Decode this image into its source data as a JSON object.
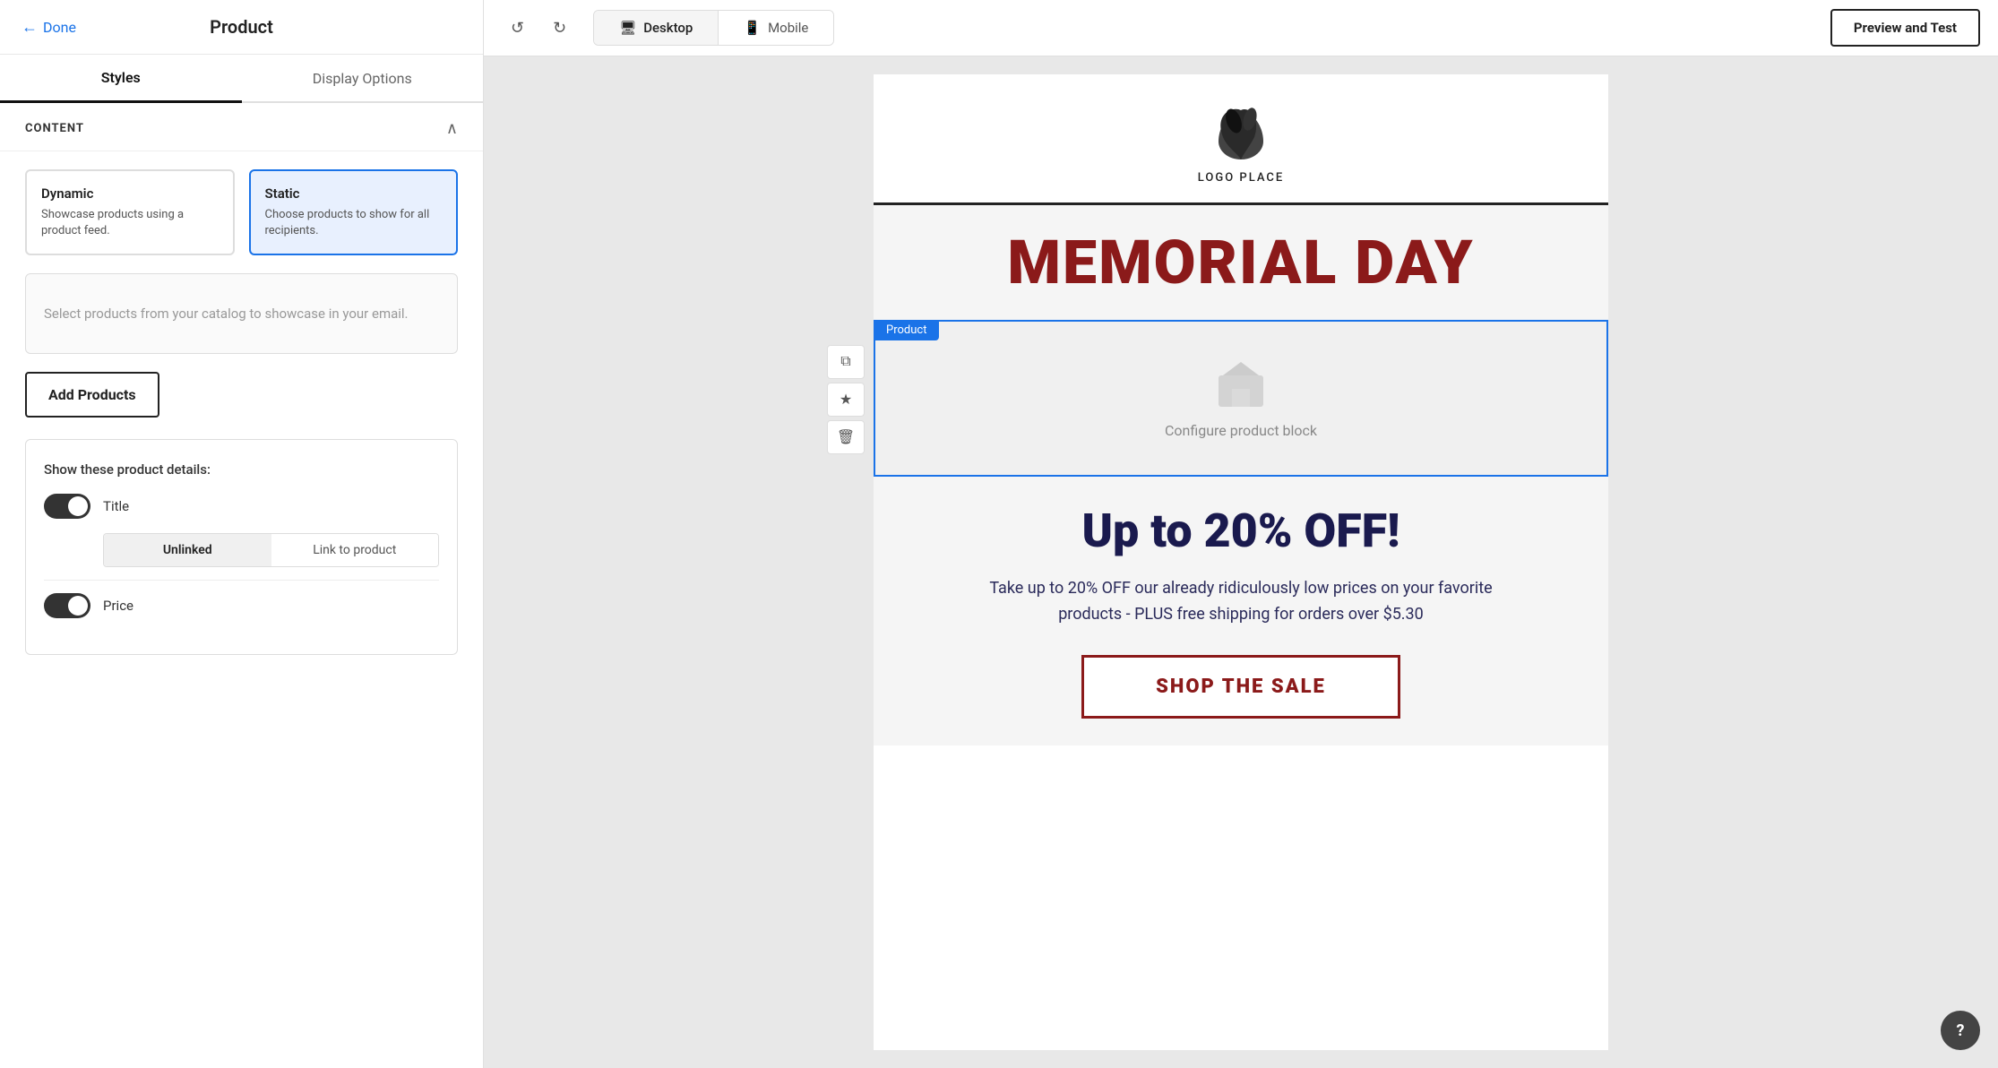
{
  "leftPanel": {
    "doneLabel": "Done",
    "title": "Product",
    "tabs": [
      {
        "id": "styles",
        "label": "Styles",
        "active": true
      },
      {
        "id": "display-options",
        "label": "Display Options",
        "active": false
      }
    ],
    "content": {
      "sectionLabel": "CONTENT",
      "contentTypes": [
        {
          "id": "dynamic",
          "title": "Dynamic",
          "desc": "Showcase products using a product feed.",
          "selected": false
        },
        {
          "id": "static",
          "title": "Static",
          "desc": "Choose products to show for all recipients.",
          "selected": true
        }
      ],
      "placeholderText": "Select products from your catalog to showcase in your email.",
      "addProductsLabel": "Add Products",
      "productDetailsLabel": "Show these product details:",
      "details": [
        {
          "id": "title",
          "label": "Title",
          "enabled": true,
          "subtoggle": {
            "options": [
              "Unlinked",
              "Link to product"
            ],
            "active": "Unlinked"
          }
        },
        {
          "id": "price",
          "label": "Price",
          "enabled": true
        }
      ]
    }
  },
  "toolbar": {
    "undoLabel": "↺",
    "redoLabel": "↻",
    "desktopLabel": "Desktop",
    "mobileLabel": "Mobile",
    "previewTestLabel": "Preview and Test"
  },
  "emailCanvas": {
    "logoText": "LOGO PLACE",
    "heroText": "MEMORIAL DAY",
    "productBlockLabel": "Product",
    "productBlockConfigText": "Configure product block",
    "promoTitle": "Up to 20% OFF!",
    "promoDesc": "Take up to 20% OFF our already ridiculously low prices on your favorite products - PLUS free shipping for orders over $5.30",
    "shopBtnLabel": "SHOP THE SALE"
  }
}
